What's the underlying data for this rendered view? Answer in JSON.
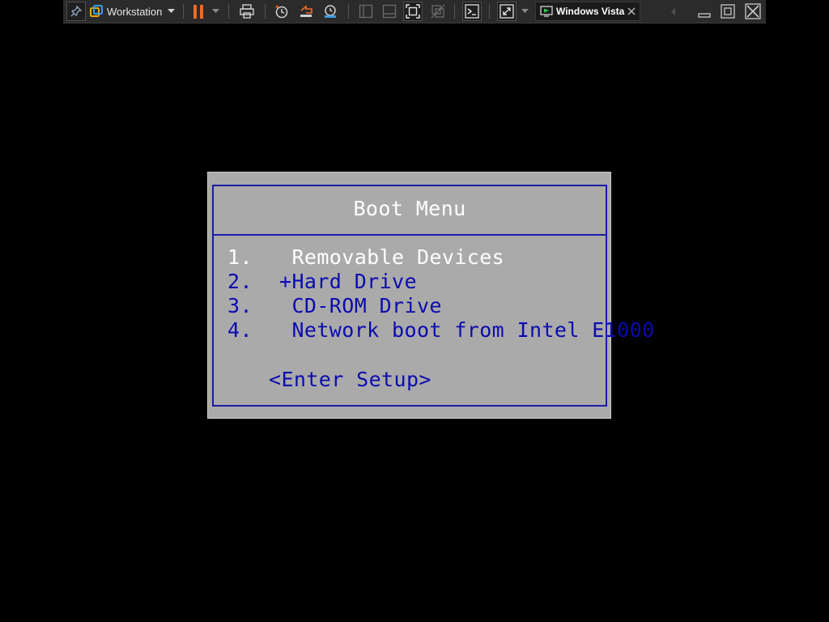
{
  "toolbar": {
    "app_name": "Workstation",
    "vm_tab_label": "Windows Vista",
    "icons": {
      "pin": "pin-icon",
      "app": "workstation-logo-icon",
      "dropdown": "chevron-down-icon",
      "pause": "pause-icon",
      "send_keys": "send-ctrl-alt-del-icon",
      "snapshot": "snapshot-icon",
      "revert": "revert-snapshot-icon",
      "snapshot_manager": "snapshot-manager-icon",
      "library_view": "library-view-icon",
      "thumbnail_view": "thumbnail-bar-icon",
      "fit": "fit-guest-icon",
      "unity": "unity-icon",
      "console": "console-view-icon",
      "fullscreen": "fullscreen-icon",
      "vm_tab": "vm-running-icon",
      "close_tab": "close-icon",
      "scroll_left": "chevron-left-icon",
      "minimize": "minimize-icon",
      "restore": "restore-icon",
      "exit": "exit-fullscreen-icon"
    },
    "colors": {
      "background": "#2b2b2b",
      "pause_accent": "#f26b21",
      "app_icon_accent": "#f3a31a"
    }
  },
  "boot_menu": {
    "title": "Boot Menu",
    "items": [
      {
        "number": "1.",
        "label": " Removable Devices",
        "selected": true
      },
      {
        "number": "2.",
        "label": "+Hard Drive",
        "selected": false
      },
      {
        "number": "3.",
        "label": " CD-ROM Drive",
        "selected": false
      },
      {
        "number": "4.",
        "label": " Network boot from Intel E1000",
        "selected": false
      }
    ],
    "setup_label": "<Enter Setup>",
    "colors": {
      "panel": "#aaaaaa",
      "frame": "#1b1baa",
      "text": "#0b0bb0",
      "highlight": "#ffffff",
      "screen": "#000000"
    }
  }
}
